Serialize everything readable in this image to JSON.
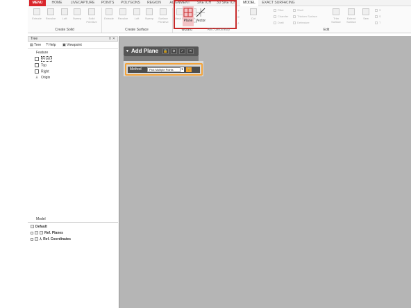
{
  "ribbon": {
    "tabs": [
      "MENU",
      "HOME",
      "LIVECAPTURE",
      "POINTS",
      "POLYGONS",
      "REGION",
      "ALIGNMENT",
      "SKETCH",
      "3D SKETCH",
      "MODEL",
      "EXACT SURFACING"
    ],
    "active_tab": "MODEL",
    "groups": {
      "create_solid": "Create Solid",
      "create_surface": "Create Surface",
      "wizard": "Wizard",
      "ref_geometry": "Ref. Geometry",
      "edit": "Edit"
    },
    "solid_buttons": [
      "Extrude",
      "Revolve",
      "Loft",
      "Sweep",
      "Solid Primitive"
    ],
    "surface_buttons": [
      "Extrude",
      "Revolve",
      "Loft",
      "Sweep",
      "Surface Primitive"
    ],
    "wizard_buttons": [
      "Mesh Fit",
      "Loft Wizard"
    ],
    "ref_buttons": [
      "Plane",
      "Vector"
    ],
    "edit_cut": "Cut",
    "edit_items": [
      "Fillet",
      "Chamfer",
      "Draft",
      "Shell",
      "Thicken Surface",
      "Defeature",
      "Trim Surface",
      "Extend Surface",
      "Sew"
    ]
  },
  "tree": {
    "title": "Tree",
    "tabs": [
      "Tree",
      "Help",
      "Viewpoint"
    ],
    "feature_header": "Feature",
    "features": [
      "Front",
      "Top",
      "Right",
      "Origin"
    ],
    "model_header": "Model",
    "model_items": [
      "Default",
      "Ref. Planes",
      "Ref. Coordinates"
    ]
  },
  "dialog": {
    "title": "Add Plane",
    "method_label": "Method",
    "method_value": "Pick Multiple Points"
  },
  "colors": {
    "menu_tab": "#d9252b",
    "highlight_box": "#c72a2a",
    "method_highlight": "#f2a33a",
    "viewport": "#b5b5b5"
  }
}
